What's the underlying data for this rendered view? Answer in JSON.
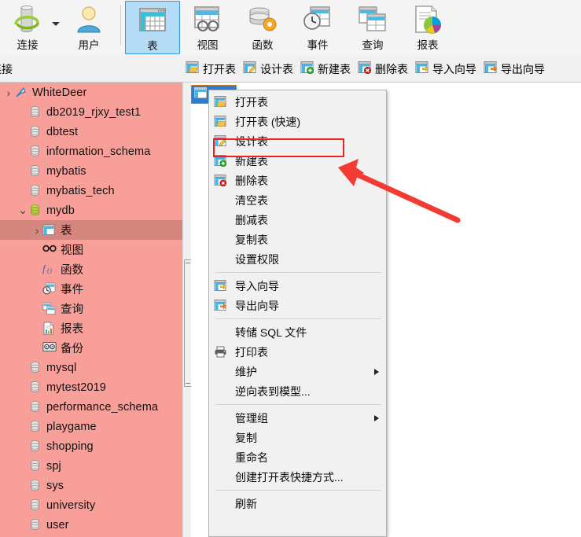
{
  "ribbon": {
    "items": [
      {
        "label": "连接",
        "icon": "connection-icon",
        "has_dropdown": true,
        "selected": false
      },
      {
        "label": "用户",
        "icon": "user-icon",
        "has_dropdown": false,
        "selected": false
      },
      {
        "label": "表",
        "icon": "table-icon",
        "has_dropdown": false,
        "selected": true
      },
      {
        "label": "视图",
        "icon": "view-icon",
        "has_dropdown": false,
        "selected": false
      },
      {
        "label": "函数",
        "icon": "function-icon",
        "has_dropdown": false,
        "selected": false
      },
      {
        "label": "事件",
        "icon": "event-icon",
        "has_dropdown": false,
        "selected": false
      },
      {
        "label": "查询",
        "icon": "query-icon",
        "has_dropdown": false,
        "selected": false
      },
      {
        "label": "报表",
        "icon": "report-icon",
        "has_dropdown": false,
        "selected": false
      }
    ]
  },
  "subtoolbar": {
    "left_label": "连接",
    "items": [
      {
        "label": "打开表",
        "icon": "open-table-icon"
      },
      {
        "label": "设计表",
        "icon": "design-table-icon"
      },
      {
        "label": "新建表",
        "icon": "new-table-icon"
      },
      {
        "label": "删除表",
        "icon": "delete-table-icon"
      },
      {
        "label": "导入向导",
        "icon": "import-wizard-icon"
      },
      {
        "label": "导出向导",
        "icon": "export-wizard-icon"
      }
    ]
  },
  "tree": {
    "nodes": [
      {
        "label": "WhiteDeer",
        "icon": "connection-arrow-icon",
        "indent": 0,
        "expander": "collapsed-caret",
        "selected": false
      },
      {
        "label": "db2019_rjxy_test1",
        "icon": "database-icon",
        "indent": 1,
        "expander": "none",
        "selected": false
      },
      {
        "label": "dbtest",
        "icon": "database-icon",
        "indent": 1,
        "expander": "none",
        "selected": false
      },
      {
        "label": "information_schema",
        "icon": "database-icon",
        "indent": 1,
        "expander": "none",
        "selected": false
      },
      {
        "label": "mybatis",
        "icon": "database-icon",
        "indent": 1,
        "expander": "none",
        "selected": false
      },
      {
        "label": "mybatis_tech",
        "icon": "database-icon",
        "indent": 1,
        "expander": "none",
        "selected": false
      },
      {
        "label": "mydb",
        "icon": "database-open-icon",
        "indent": 1,
        "expander": "expanded",
        "selected": false
      },
      {
        "label": "表",
        "icon": "table-icon",
        "indent": 2,
        "expander": "collapsed",
        "selected": true
      },
      {
        "label": "视图",
        "icon": "view-glasses-icon",
        "indent": 2,
        "expander": "none",
        "selected": false
      },
      {
        "label": "函数",
        "icon": "function-fx-icon",
        "indent": 2,
        "expander": "none",
        "selected": false
      },
      {
        "label": "事件",
        "icon": "event-icon",
        "indent": 2,
        "expander": "none",
        "selected": false
      },
      {
        "label": "查询",
        "icon": "query-icon",
        "indent": 2,
        "expander": "none",
        "selected": false
      },
      {
        "label": "报表",
        "icon": "report-icon",
        "indent": 2,
        "expander": "none",
        "selected": false
      },
      {
        "label": "备份",
        "icon": "backup-icon",
        "indent": 2,
        "expander": "none",
        "selected": false
      },
      {
        "label": "mysql",
        "icon": "database-icon",
        "indent": 1,
        "expander": "none",
        "selected": false
      },
      {
        "label": "mytest2019",
        "icon": "database-icon",
        "indent": 1,
        "expander": "none",
        "selected": false
      },
      {
        "label": "performance_schema",
        "icon": "database-icon",
        "indent": 1,
        "expander": "none",
        "selected": false
      },
      {
        "label": "playgame",
        "icon": "database-icon",
        "indent": 1,
        "expander": "none",
        "selected": false
      },
      {
        "label": "shopping",
        "icon": "database-icon",
        "indent": 1,
        "expander": "none",
        "selected": false
      },
      {
        "label": "spj",
        "icon": "database-icon",
        "indent": 1,
        "expander": "none",
        "selected": false
      },
      {
        "label": "sys",
        "icon": "database-icon",
        "indent": 1,
        "expander": "none",
        "selected": false
      },
      {
        "label": "university",
        "icon": "database-icon",
        "indent": 1,
        "expander": "none",
        "selected": false
      },
      {
        "label": "user",
        "icon": "database-icon",
        "indent": 1,
        "expander": "none",
        "selected": false
      }
    ]
  },
  "context_menu": {
    "items": [
      {
        "label": "打开表",
        "icon": "open-table-icon",
        "type": "item"
      },
      {
        "label": "打开表 (快速)",
        "icon": "open-table-icon",
        "type": "item"
      },
      {
        "label": "设计表",
        "icon": "design-table-icon",
        "type": "item",
        "highlighted": true
      },
      {
        "label": "新建表",
        "icon": "new-table-icon",
        "type": "item"
      },
      {
        "label": "删除表",
        "icon": "delete-table-icon",
        "type": "item"
      },
      {
        "label": "清空表",
        "icon": "none",
        "type": "item"
      },
      {
        "label": "删减表",
        "icon": "none",
        "type": "item"
      },
      {
        "label": "复制表",
        "icon": "none",
        "type": "item"
      },
      {
        "label": "设置权限",
        "icon": "none",
        "type": "item"
      },
      {
        "label": "",
        "icon": "none",
        "type": "separator"
      },
      {
        "label": "导入向导",
        "icon": "import-wizard-icon",
        "type": "item"
      },
      {
        "label": "导出向导",
        "icon": "export-wizard-icon",
        "type": "item"
      },
      {
        "label": "",
        "icon": "none",
        "type": "separator"
      },
      {
        "label": "转储 SQL 文件",
        "icon": "none",
        "type": "item"
      },
      {
        "label": "打印表",
        "icon": "printer-icon",
        "type": "item"
      },
      {
        "label": "维护",
        "icon": "none",
        "type": "submenu"
      },
      {
        "label": "逆向表到模型...",
        "icon": "none",
        "type": "item"
      },
      {
        "label": "",
        "icon": "none",
        "type": "separator"
      },
      {
        "label": "管理组",
        "icon": "none",
        "type": "submenu"
      },
      {
        "label": "复制",
        "icon": "none",
        "type": "item"
      },
      {
        "label": "重命名",
        "icon": "none",
        "type": "item"
      },
      {
        "label": "创建打开表快捷方式...",
        "icon": "none",
        "type": "item"
      },
      {
        "label": "",
        "icon": "none",
        "type": "separator"
      },
      {
        "label": "刷新",
        "icon": "none",
        "type": "item"
      }
    ]
  },
  "annotations": {
    "highlight_color": "#ef2020",
    "arrow_color": "#f43b33",
    "highlight_target": "设计表"
  },
  "colors": {
    "sidebar_background": "#f99f99",
    "sidebar_selected": "#d4867f",
    "ribbon_selected": "#b5dcf7",
    "ribbon_selected_border": "#3c93d6",
    "menu_background": "#f1f1f1",
    "object_selected": "#2b7cd3"
  }
}
